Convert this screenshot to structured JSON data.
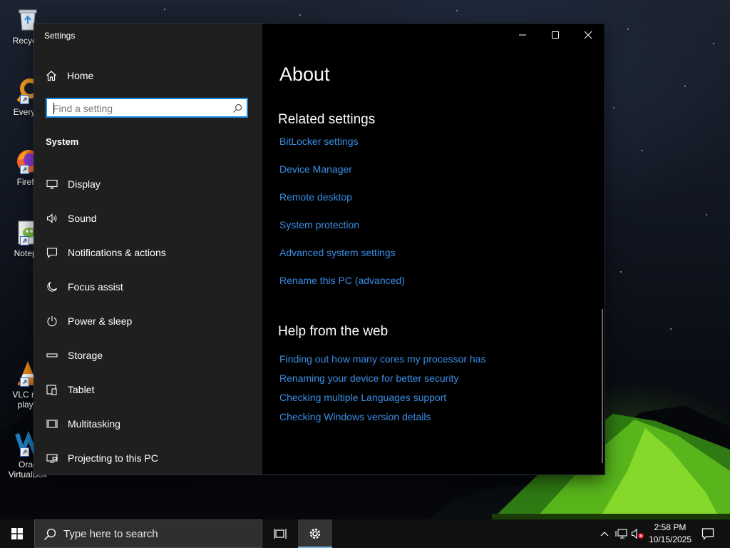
{
  "desktop": {
    "icons": [
      {
        "label": "Recycle",
        "icon": "recycle-bin-icon"
      },
      {
        "label": "Everyth",
        "icon": "everything-search-icon"
      },
      {
        "label": "Firefo",
        "icon": "firefox-icon"
      },
      {
        "label": "Notepa",
        "icon": "notepad-plus-plus-icon"
      },
      {
        "label": "VLC me",
        "label2": "playe",
        "icon": "vlc-icon"
      },
      {
        "label": "Orac",
        "label2": "VirtualBox",
        "icon": "virtualbox-icon"
      }
    ]
  },
  "window": {
    "title": "Settings",
    "controls": {
      "minimize": "minimize-icon",
      "maximize": "maximize-icon",
      "close": "close-icon"
    }
  },
  "sidebar": {
    "home_label": "Home",
    "search_placeholder": "Find a setting",
    "section_title": "System",
    "items": [
      {
        "label": "Display",
        "icon": "display-icon"
      },
      {
        "label": "Sound",
        "icon": "sound-icon"
      },
      {
        "label": "Notifications & actions",
        "icon": "notifications-icon"
      },
      {
        "label": "Focus assist",
        "icon": "moon-icon"
      },
      {
        "label": "Power & sleep",
        "icon": "power-icon"
      },
      {
        "label": "Storage",
        "icon": "storage-icon"
      },
      {
        "label": "Tablet",
        "icon": "tablet-icon"
      },
      {
        "label": "Multitasking",
        "icon": "multitasking-icon"
      },
      {
        "label": "Projecting to this PC",
        "icon": "projecting-icon"
      }
    ]
  },
  "main": {
    "page_title": "About",
    "related_heading": "Related settings",
    "related_links": [
      "BitLocker settings",
      "Device Manager",
      "Remote desktop",
      "System protection",
      "Advanced system settings",
      "Rename this PC (advanced)"
    ],
    "help_heading": "Help from the web",
    "help_links": [
      "Finding out how many cores my processor has",
      "Renaming your device for better security",
      "Checking multiple Languages support",
      "Checking Windows version details"
    ]
  },
  "taskbar": {
    "search_placeholder": "Type here to search",
    "time": "2:58 PM",
    "date": "10/15/2025"
  },
  "colors": {
    "link": "#3a8fe6",
    "accent": "#1a86d9",
    "sidebar_bg": "#1f1f1f",
    "content_bg": "#000000"
  }
}
